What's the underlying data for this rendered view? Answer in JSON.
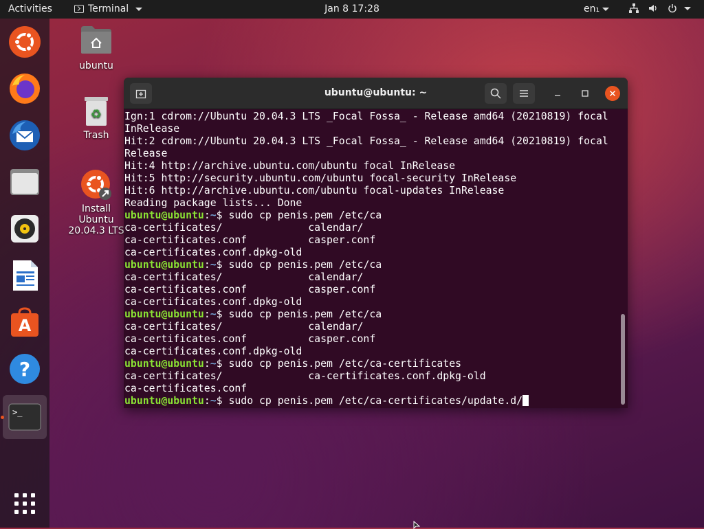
{
  "topbar": {
    "activities": "Activities",
    "app_name": "Terminal",
    "clock": "Jan 8  17:28",
    "lang": "en₁"
  },
  "dock": {
    "items": [
      {
        "name": "ubuntu-installer"
      },
      {
        "name": "firefox"
      },
      {
        "name": "thunderbird"
      },
      {
        "name": "files"
      },
      {
        "name": "rhythmbox"
      },
      {
        "name": "libreoffice-writer"
      },
      {
        "name": "ubuntu-software"
      },
      {
        "name": "help"
      },
      {
        "name": "terminal"
      }
    ],
    "show_apps_label": "Show Applications"
  },
  "desktop": {
    "home_label": "ubuntu",
    "trash_label": "Trash",
    "installer_label_1": "Install Ubuntu",
    "installer_label_2": "20.04.3 LTS"
  },
  "terminal": {
    "title": "ubuntu@ubuntu: ~",
    "prompt_user": "ubuntu@ubuntu",
    "prompt_path": "~",
    "lines": [
      {
        "type": "out",
        "text": "Ign:1 cdrom://Ubuntu 20.04.3 LTS _Focal Fossa_ - Release amd64 (20210819) focal"
      },
      {
        "type": "out",
        "text": "InRelease"
      },
      {
        "type": "out",
        "text": "Hit:2 cdrom://Ubuntu 20.04.3 LTS _Focal Fossa_ - Release amd64 (20210819) focal"
      },
      {
        "type": "out",
        "text": "Release"
      },
      {
        "type": "out",
        "text": "Hit:4 http://archive.ubuntu.com/ubuntu focal InRelease"
      },
      {
        "type": "out",
        "text": "Hit:5 http://security.ubuntu.com/ubuntu focal-security InRelease"
      },
      {
        "type": "out",
        "text": "Hit:6 http://archive.ubuntu.com/ubuntu focal-updates InRelease"
      },
      {
        "type": "out",
        "text": "Reading package lists... Done"
      },
      {
        "type": "cmd",
        "text": "sudo cp penis.pem /etc/ca"
      },
      {
        "type": "out",
        "text": "ca-certificates/              calendar/"
      },
      {
        "type": "out",
        "text": "ca-certificates.conf          casper.conf"
      },
      {
        "type": "out",
        "text": "ca-certificates.conf.dpkg-old"
      },
      {
        "type": "cmd",
        "text": "sudo cp penis.pem /etc/ca"
      },
      {
        "type": "out",
        "text": "ca-certificates/              calendar/"
      },
      {
        "type": "out",
        "text": "ca-certificates.conf          casper.conf"
      },
      {
        "type": "out",
        "text": "ca-certificates.conf.dpkg-old"
      },
      {
        "type": "cmd",
        "text": "sudo cp penis.pem /etc/ca"
      },
      {
        "type": "out",
        "text": "ca-certificates/              calendar/"
      },
      {
        "type": "out",
        "text": "ca-certificates.conf          casper.conf"
      },
      {
        "type": "out",
        "text": "ca-certificates.conf.dpkg-old"
      },
      {
        "type": "cmd",
        "text": "sudo cp penis.pem /etc/ca-certificates"
      },
      {
        "type": "out",
        "text": "ca-certificates/              ca-certificates.conf.dpkg-old"
      },
      {
        "type": "out",
        "text": "ca-certificates.conf"
      },
      {
        "type": "cmd",
        "text": "sudo cp penis.pem /etc/ca-certificates/update.d/",
        "cursor": true
      }
    ]
  }
}
